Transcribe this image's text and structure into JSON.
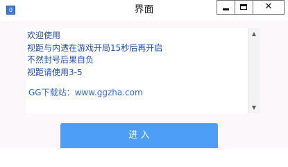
{
  "window": {
    "title": "界面",
    "icon_label": "0",
    "icon_name": "app-icon",
    "controls": {
      "minimize_icon": "minimize-icon",
      "maximize_icon": "maximize-icon",
      "close_label": "✕"
    }
  },
  "textbox": {
    "lines": [
      "欢迎使用",
      "视距与内透在游戏开局15秒后再开启",
      "不然封号后果自负",
      "视距请使用3-5"
    ],
    "watermark": "GG下载站：www.ggzha.com",
    "scroll_up_label": "▲",
    "scroll_down_label": "▼"
  },
  "enter_button": {
    "label": "进 入"
  },
  "colors": {
    "window_bg": "#fbf7fa",
    "text": "#1f4fb5",
    "button": "#4c9ef6",
    "button_text": "#ffffff"
  }
}
